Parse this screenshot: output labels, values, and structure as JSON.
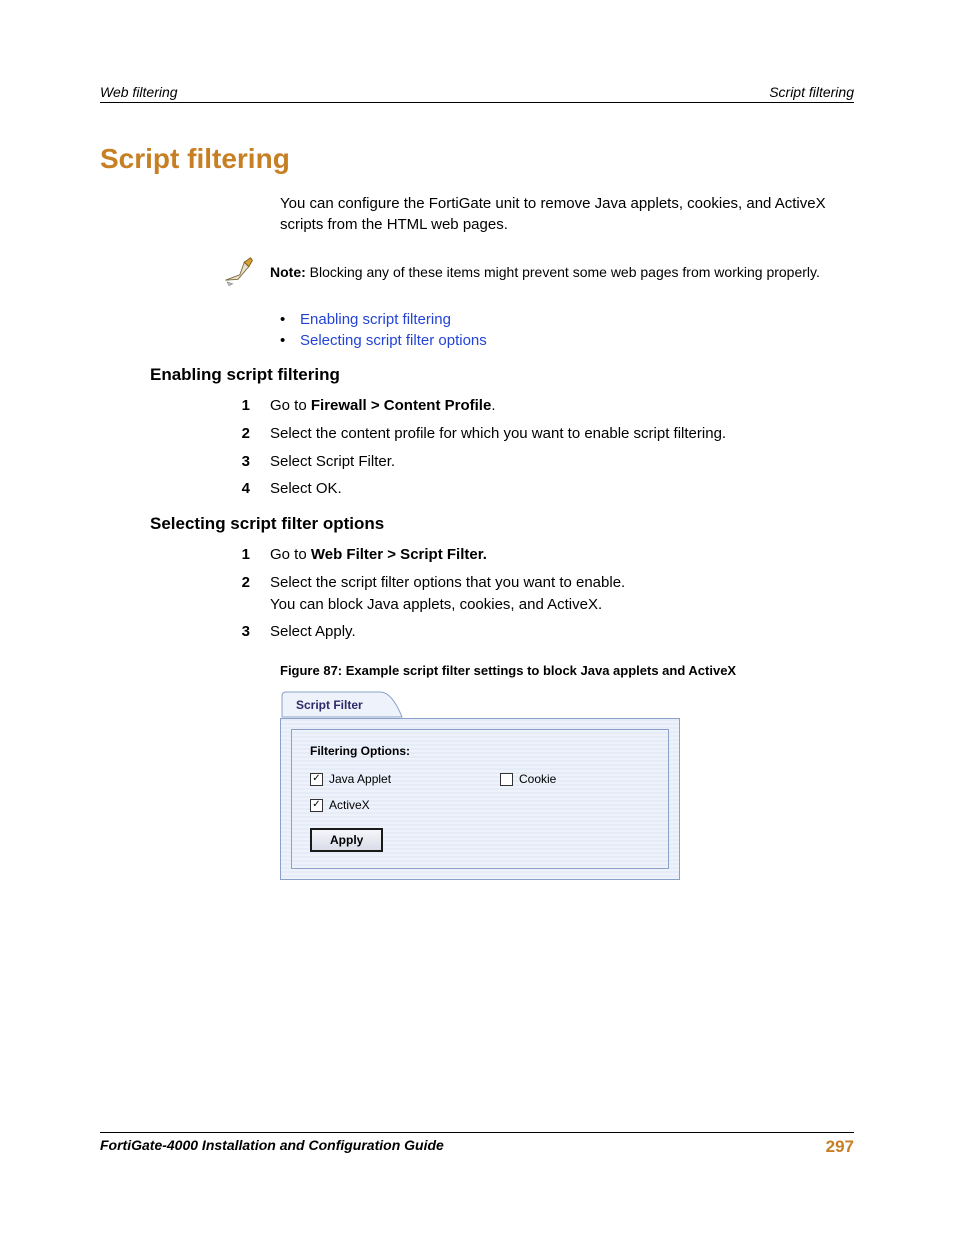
{
  "header": {
    "left": "Web filtering",
    "right": "Script filtering"
  },
  "title": "Script filtering",
  "intro": "You can configure the FortiGate unit to remove Java applets, cookies, and ActiveX scripts from the HTML web pages.",
  "note": {
    "label": "Note:",
    "text": " Blocking any of these items might prevent some web pages from working properly."
  },
  "links": {
    "a": "Enabling script filtering",
    "b": "Selecting script filter options"
  },
  "sec1": {
    "heading": "Enabling script filtering",
    "s1_pre": "Go to ",
    "s1_bold": "Firewall > Content Profile",
    "s1_post": ".",
    "s2": "Select the content profile for which you want to enable script filtering.",
    "s3": "Select Script Filter.",
    "s4": "Select OK."
  },
  "sec2": {
    "heading": "Selecting script filter options",
    "s1_pre": "Go to ",
    "s1_bold": "Web Filter > Script Filter.",
    "s2a": "Select the script filter options that you want to enable.",
    "s2b": "You can block Java applets, cookies, and ActiveX.",
    "s3": "Select Apply."
  },
  "figure": {
    "caption": "Figure 87: Example script filter settings to block Java applets and ActiveX",
    "tab": "Script Filter",
    "group": "Filtering Options:",
    "cb_java": "Java Applet",
    "cb_cookie": "Cookie",
    "cb_activex": "ActiveX",
    "apply": "Apply",
    "checked": {
      "java": true,
      "cookie": false,
      "activex": true
    }
  },
  "footer": {
    "guide": "FortiGate-4000 Installation and Configuration Guide",
    "page": "297"
  },
  "nums": {
    "n1": "1",
    "n2": "2",
    "n3": "3",
    "n4": "4"
  },
  "glyphs": {
    "bullet": "•",
    "check": "✓"
  }
}
